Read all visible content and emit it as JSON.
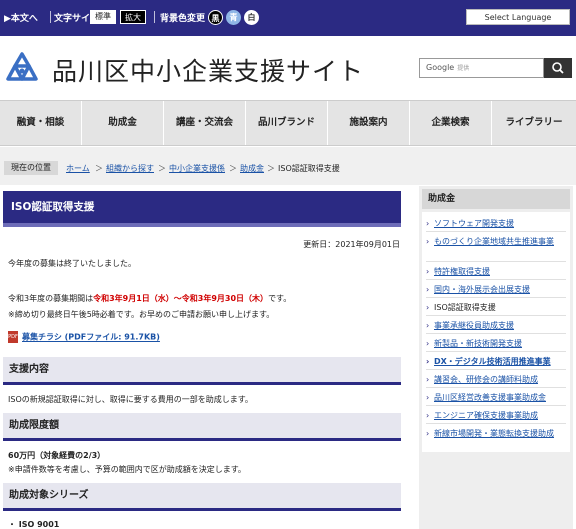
{
  "topbar": {
    "skip_link": "▶本文へ",
    "font_size_label": "文字サイズ",
    "font_standard": "標準",
    "font_large": "拡大",
    "bg_color_label": "背景色変更",
    "bg_black": "黒",
    "bg_blue": "青",
    "bg_white": "白",
    "language": "Select Language"
  },
  "header": {
    "site_title": "品川区中小企業支援サイト",
    "search_brand": "Google",
    "search_brand_sub": "提供",
    "logo_color": "#3a6fc4"
  },
  "nav": {
    "items": [
      "融資・相談",
      "助成金",
      "講座・交流会",
      "品川ブランド",
      "施設案内",
      "企業検索",
      "ライブラリー"
    ]
  },
  "breadcrumb": {
    "label": "現在の位置",
    "items": [
      "ホーム",
      "組織から探す",
      "中小企業支援係",
      "助成金",
      "ISO認証取得支援"
    ]
  },
  "main": {
    "title": "ISO認証取得支援",
    "updated": "更新日：2021年09月01日",
    "notice": "今年度の募集は終了いたしました。",
    "period_prefix": "令和3年度の募集期間は",
    "period_dates": "令和3年9月1日（水）～令和3年9月30日（木）",
    "period_suffix": "です。",
    "deadline_note": "※締め切り最終日午後5時必着です。お早めのご申請お願い申し上げます。",
    "pdf_icon": "PDF",
    "pdf_link": "募集チラシ (PDFファイル: 91.7KB)",
    "sections": [
      {
        "heading": "支援内容",
        "body": [
          "ISOの新規認証取得に対し、取得に要する費用の一部を助成します。"
        ]
      },
      {
        "heading": "助成限度額",
        "body": [
          "60万円（対象経費の2/3）",
          "※申請件数等を考慮し、予算の範囲内で区が助成額を決定します。"
        ]
      },
      {
        "heading": "助成対象シリーズ",
        "body": [
          "・ ISO 9001"
        ]
      }
    ]
  },
  "sidebar": {
    "heading": "助成金",
    "items": [
      "ソフトウェア開発支援",
      "ものづくり企業地域共生推進事業",
      "特許権取得支援",
      "国内・海外展示会出展支援",
      "ISO認証取得支援",
      "事業承継役員助成支援",
      "新製品・新技術開発支援",
      "DX・デジタル技術活用推進事業",
      "講習会、研修会の講師料助成",
      "品川区経営改善支援事業助成金",
      "エンジニア確保支援事業助成",
      "新線市場開発・業態転換支援助成"
    ]
  },
  "colors": {
    "primary": "#2b2a83",
    "link": "#1a52a6",
    "alert": "#d00000"
  }
}
